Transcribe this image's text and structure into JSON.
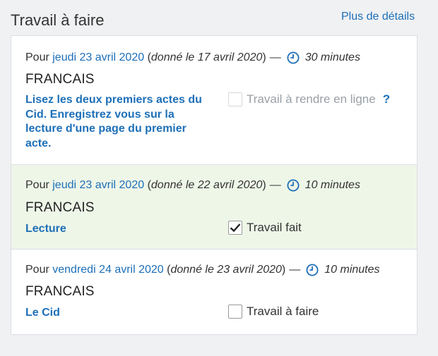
{
  "header": {
    "title": "Travail à faire",
    "details_link": "Plus de détails"
  },
  "items": [
    {
      "prefix": "Pour",
      "due_date": "jeudi 23 avril 2020",
      "given_open": "(",
      "given": "donné le 17 avril 2020",
      "given_close": ")",
      "dash": "—",
      "duration": "30 minutes",
      "subject": "FRANCAIS",
      "description": "Lisez les deux premiers actes du Cid. Enregistrez vous sur la lecture d'une page du premier acte.",
      "checkbox_label": "Travail à rendre en ligne",
      "checked": false,
      "disabled": true,
      "help": "?"
    },
    {
      "prefix": "Pour",
      "due_date": "jeudi 23 avril 2020",
      "given_open": "(",
      "given": "donné le 22 avril 2020",
      "given_close": ")",
      "dash": "—",
      "duration": "10 minutes",
      "subject": "FRANCAIS",
      "description": "Lecture",
      "checkbox_label": "Travail fait",
      "checked": true,
      "disabled": false
    },
    {
      "prefix": "Pour",
      "due_date": "vendredi 24 avril 2020",
      "given_open": "(",
      "given": "donné le 23 avril 2020",
      "given_close": ")",
      "dash": "—",
      "duration": "10 minutes",
      "subject": "FRANCAIS",
      "description": "Le Cid",
      "checkbox_label": "Travail à faire",
      "checked": false,
      "disabled": false
    }
  ],
  "colors": {
    "accent": "#1d6fb8",
    "done_background": "#eef6e8"
  },
  "icons": {
    "clock": "clock-icon",
    "check": "check-icon"
  }
}
